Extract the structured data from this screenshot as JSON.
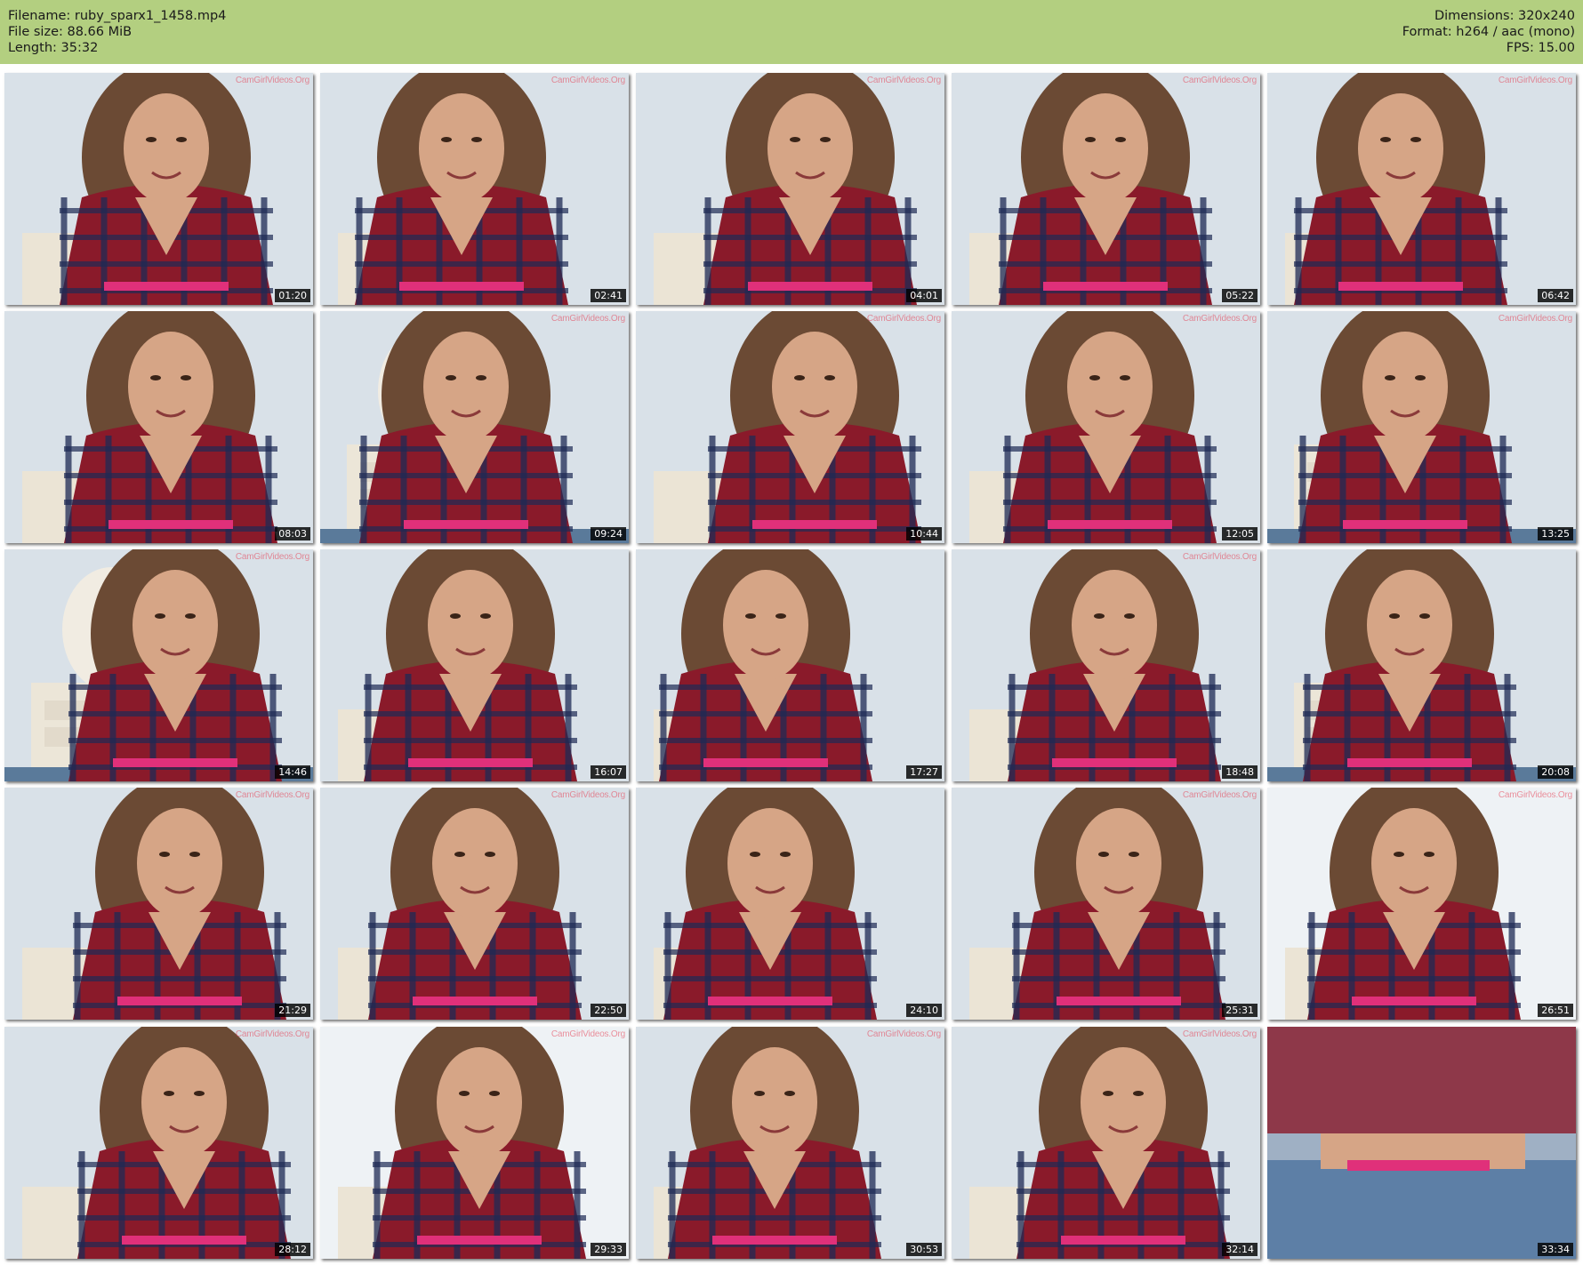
{
  "header": {
    "left": [
      "Filename: ruby_sparx1_1458.mp4",
      "File size: 88.66 MiB",
      "Length: 35:32"
    ],
    "right": [
      "Dimensions: 320x240",
      "Format: h264 / aac (mono)",
      "FPS: 15.00"
    ]
  },
  "watermark_text": "CamGirlVideos.Org",
  "thumbnails": [
    {
      "time": "01:20",
      "watermark": true,
      "scene": "closeup"
    },
    {
      "time": "02:41",
      "watermark": true,
      "scene": "closeup"
    },
    {
      "time": "04:01",
      "watermark": true,
      "scene": "closeup"
    },
    {
      "time": "05:22",
      "watermark": true,
      "scene": "closeup"
    },
    {
      "time": "06:42",
      "watermark": true,
      "scene": "closeup"
    },
    {
      "time": "08:03",
      "watermark": false,
      "scene": "closeup"
    },
    {
      "time": "09:24",
      "watermark": true,
      "scene": "room"
    },
    {
      "time": "10:44",
      "watermark": true,
      "scene": "closeup"
    },
    {
      "time": "12:05",
      "watermark": true,
      "scene": "closeup"
    },
    {
      "time": "13:25",
      "watermark": true,
      "scene": "room"
    },
    {
      "time": "14:46",
      "watermark": true,
      "scene": "room"
    },
    {
      "time": "16:07",
      "watermark": false,
      "scene": "closeup"
    },
    {
      "time": "17:27",
      "watermark": false,
      "scene": "closeup"
    },
    {
      "time": "18:48",
      "watermark": true,
      "scene": "closeup"
    },
    {
      "time": "20:08",
      "watermark": false,
      "scene": "room"
    },
    {
      "time": "21:29",
      "watermark": true,
      "scene": "closeup"
    },
    {
      "time": "22:50",
      "watermark": true,
      "scene": "closeup"
    },
    {
      "time": "24:10",
      "watermark": false,
      "scene": "closeup"
    },
    {
      "time": "25:31",
      "watermark": true,
      "scene": "closeup"
    },
    {
      "time": "26:51",
      "watermark": true,
      "scene": "bright"
    },
    {
      "time": "28:12",
      "watermark": true,
      "scene": "closeup"
    },
    {
      "time": "29:33",
      "watermark": true,
      "scene": "bright"
    },
    {
      "time": "30:53",
      "watermark": true,
      "scene": "closeup"
    },
    {
      "time": "32:14",
      "watermark": true,
      "scene": "closeup"
    },
    {
      "time": "33:34",
      "watermark": false,
      "scene": "blur"
    }
  ],
  "colors": {
    "header_bg": "#b3cf80",
    "wall": "#d9e1e8",
    "shirt_red": "#8a1a2a",
    "shirt_navy": "#1e2a55",
    "hair": "#6b4a34",
    "skin": "#d6a586",
    "accent_pink": "#e0307a"
  }
}
